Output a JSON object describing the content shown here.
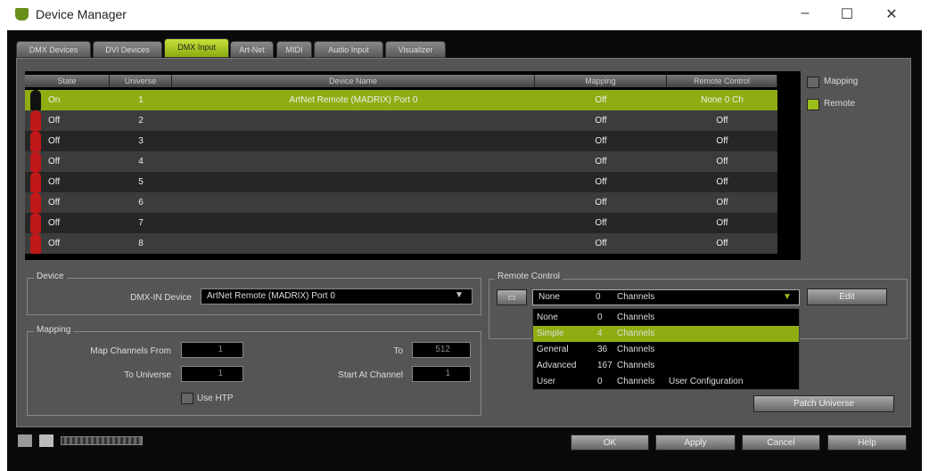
{
  "window": {
    "title": "Device Manager",
    "minimize": "–",
    "maximize": "☐",
    "close": "✕"
  },
  "tabs": [
    "DMX Devices",
    "DVI Devices",
    "DMX Input",
    "Art-Net",
    "MIDI",
    "Audio Input",
    "Visualizer"
  ],
  "active_tab": "DMX Input",
  "table": {
    "headers": [
      "State",
      "Universe",
      "Device Name",
      "Mapping",
      "Remote Control"
    ],
    "rows": [
      {
        "state": "On",
        "universe": "1",
        "device": "ArtNet Remote (MADRIX) Port 0",
        "mapping": "Off",
        "remote": "None  0 Ch"
      },
      {
        "state": "Off",
        "universe": "2",
        "device": "",
        "mapping": "Off",
        "remote": "Off"
      },
      {
        "state": "Off",
        "universe": "3",
        "device": "",
        "mapping": "Off",
        "remote": "Off"
      },
      {
        "state": "Off",
        "universe": "4",
        "device": "",
        "mapping": "Off",
        "remote": "Off"
      },
      {
        "state": "Off",
        "universe": "5",
        "device": "",
        "mapping": "Off",
        "remote": "Off"
      },
      {
        "state": "Off",
        "universe": "6",
        "device": "",
        "mapping": "Off",
        "remote": "Off"
      },
      {
        "state": "Off",
        "universe": "7",
        "device": "",
        "mapping": "Off",
        "remote": "Off"
      },
      {
        "state": "Off",
        "universe": "8",
        "device": "",
        "mapping": "Off",
        "remote": "Off"
      }
    ]
  },
  "side": {
    "mapping": "Mapping",
    "remote": "Remote"
  },
  "device": {
    "group": "Device",
    "label": "DMX-IN Device",
    "value": "ArtNet Remote (MADRIX) Port 0"
  },
  "mapping": {
    "group": "Mapping",
    "from_label": "Map Channels From",
    "from": "1",
    "to_label": "To",
    "to": "512",
    "universe_label": "To Universe",
    "universe": "1",
    "start_label": "Start At Channel",
    "start": "1",
    "htp": "Use HTP"
  },
  "remote": {
    "group": "Remote Control",
    "selected": {
      "name": "None",
      "count": "0",
      "unit": "Channels"
    },
    "edit": "Edit",
    "options": [
      {
        "name": "None",
        "count": "0",
        "unit": "Channels",
        "extra": ""
      },
      {
        "name": "Simple",
        "count": "4",
        "unit": "Channels",
        "extra": ""
      },
      {
        "name": "General",
        "count": "36",
        "unit": "Channels",
        "extra": ""
      },
      {
        "name": "Advanced",
        "count": "167",
        "unit": "Channels",
        "extra": ""
      },
      {
        "name": "User",
        "count": "0",
        "unit": "Channels",
        "extra": "User Configuration"
      }
    ],
    "patch": "Patch Universe"
  },
  "footer": {
    "ok": "OK",
    "apply": "Apply",
    "cancel": "Cancel",
    "help": "Help"
  },
  "colors": {
    "accent": "#8fad12"
  }
}
